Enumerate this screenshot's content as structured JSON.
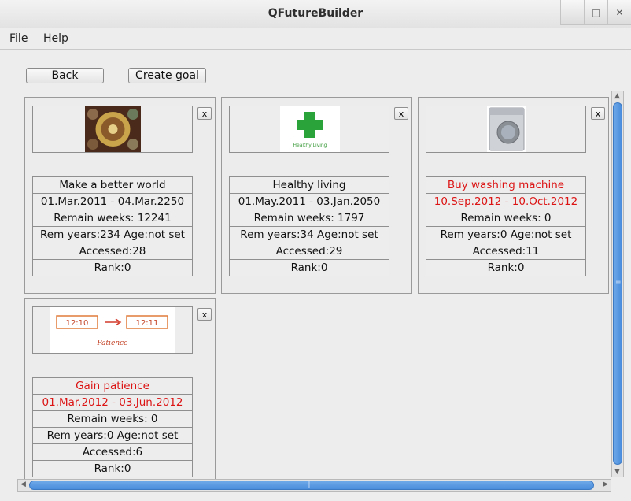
{
  "window": {
    "title": "QFutureBuilder"
  },
  "window_buttons": [
    {
      "name": "minimize-button",
      "label": "–"
    },
    {
      "name": "maximize-button",
      "label": "□"
    },
    {
      "name": "close-button",
      "label": "✕"
    }
  ],
  "menu": {
    "file": "File",
    "help": "Help"
  },
  "toolbar": {
    "back": "Back",
    "create_goal": "Create goal"
  },
  "goals": [
    {
      "image": "dark-circular-painting",
      "title": "Make a better world",
      "dates": "01.Mar.2011 - 04.Mar.2250",
      "remain_weeks": "Remain weeks: 12241",
      "rem_years": "Rem years:234 Age:not set",
      "accessed": "Accessed:28",
      "rank": "Rank:0",
      "highlight": false
    },
    {
      "image": "green-cross-logo",
      "image_caption": "Healthy Living",
      "title": "Healthy living",
      "dates": "01.May.2011 - 03.Jan.2050",
      "remain_weeks": "Remain weeks: 1797",
      "rem_years": "Rem years:34 Age:not set",
      "accessed": "Accessed:29",
      "rank": "Rank:0",
      "highlight": false
    },
    {
      "image": "washing-machine",
      "title": "Buy washing machine",
      "dates": "10.Sep.2012 - 10.Oct.2012",
      "remain_weeks": "Remain weeks: 0",
      "rem_years": "Rem years:0 Age:not set",
      "accessed": "Accessed:11",
      "rank": "Rank:0",
      "highlight": true
    },
    {
      "image": "clock-times-diagram",
      "image_texts": [
        "12:10",
        "12:11",
        "Patience"
      ],
      "title": "Gain patience",
      "dates": "01.Mar.2012 - 03.Jun.2012",
      "remain_weeks": "Remain weeks: 0",
      "rem_years": "Rem years:0 Age:not set",
      "accessed": "Accessed:6",
      "rank": "Rank:0",
      "highlight": true
    }
  ],
  "close_label": "x",
  "colors": {
    "highlight": "#dc1414",
    "scroll_thumb": "#4a8ddc"
  }
}
